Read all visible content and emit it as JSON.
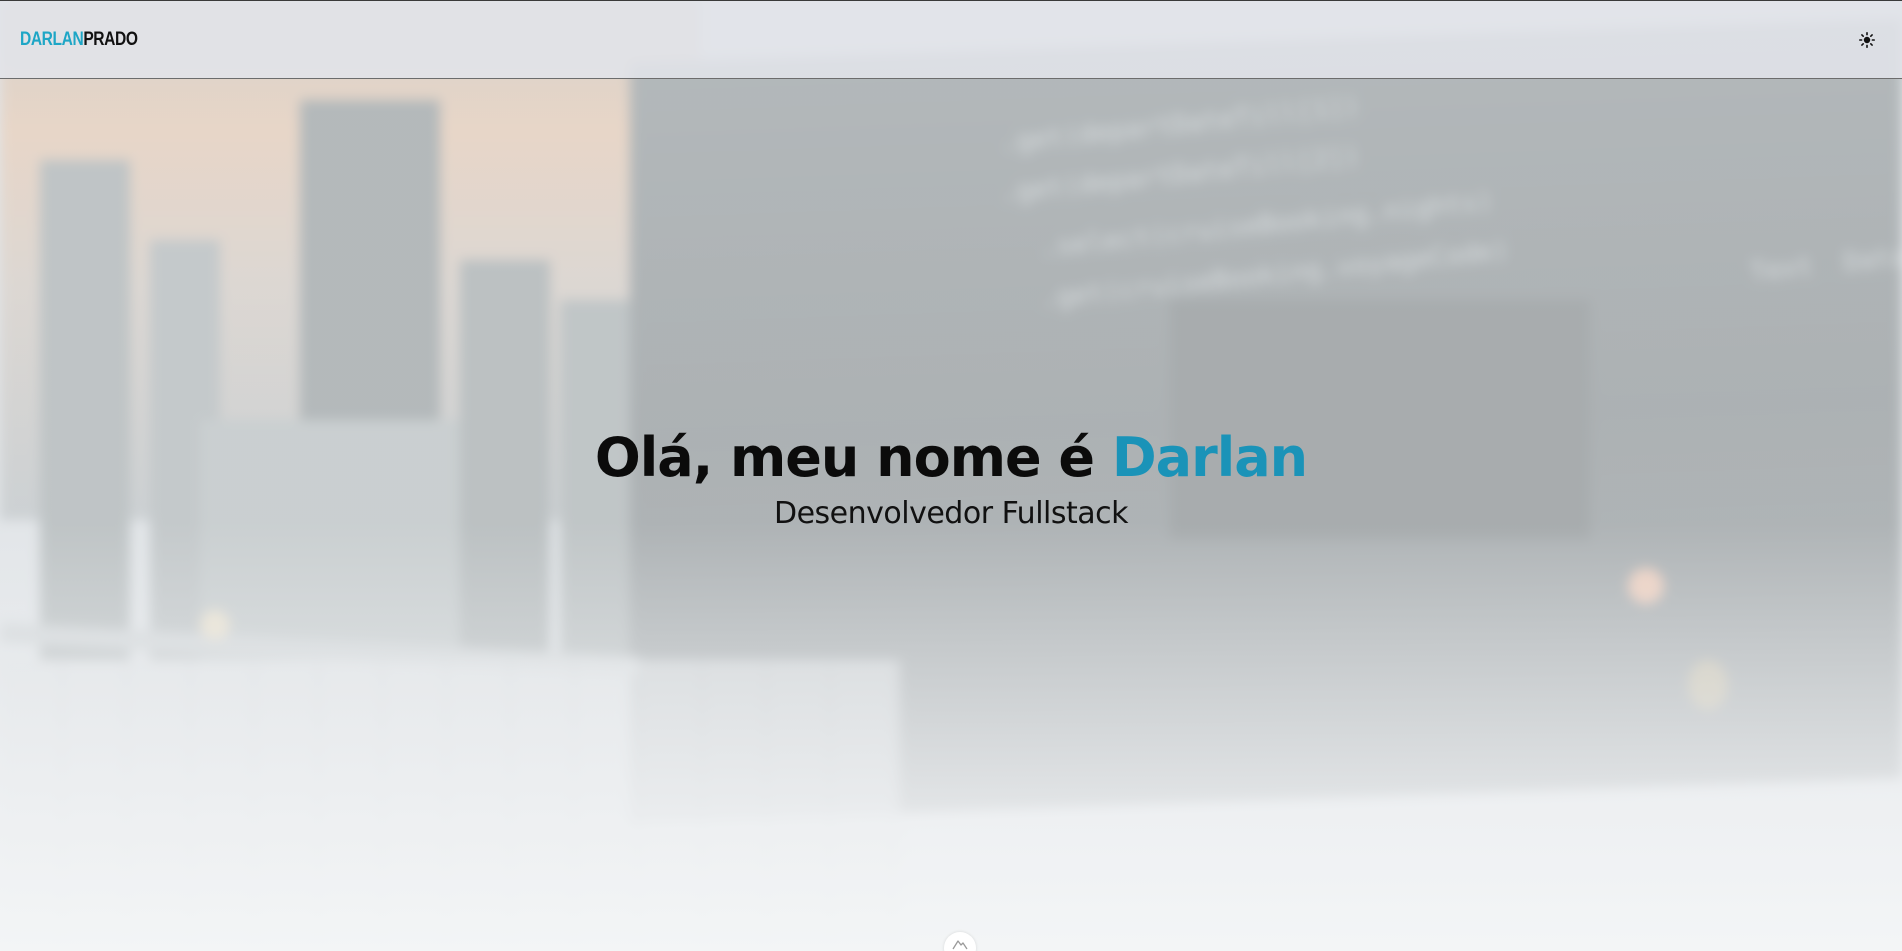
{
  "header": {
    "logo_first": "DARLAN",
    "logo_second": "PRADO",
    "theme_toggle_icon": "sun-icon"
  },
  "hero": {
    "greeting": "Olá, meu nome é ",
    "name": "Darlan",
    "subtitle": "Desenvolvedor Fullstack"
  },
  "scroll_indicator": {
    "icon": "mountain-icon"
  },
  "colors": {
    "accent": "#1a93b8",
    "logo_accent": "#1ea6c6",
    "text": "#0b0b0b"
  }
}
